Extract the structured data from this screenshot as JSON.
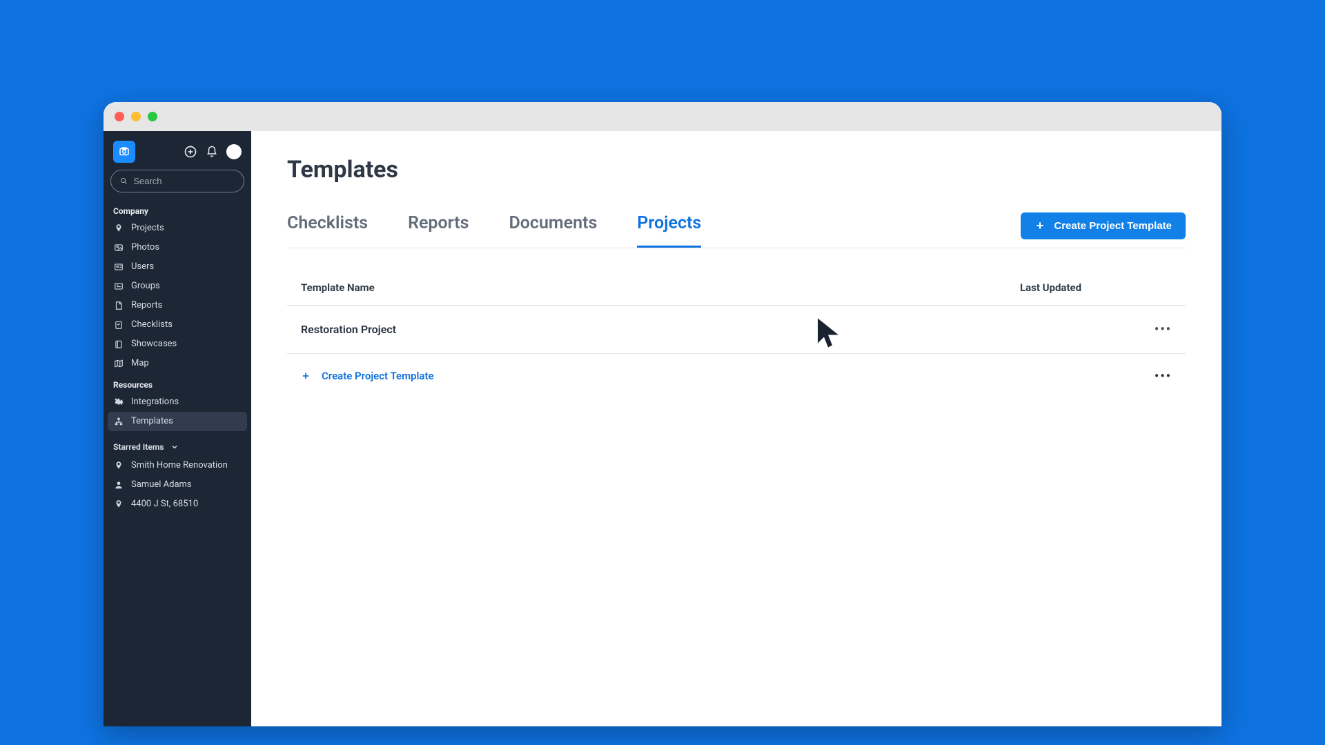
{
  "sidebar": {
    "search_placeholder": "Search",
    "sections": {
      "company": {
        "label": "Company",
        "items": [
          {
            "label": "Projects",
            "icon": "pin"
          },
          {
            "label": "Photos",
            "icon": "image"
          },
          {
            "label": "Users",
            "icon": "user-card"
          },
          {
            "label": "Groups",
            "icon": "group"
          },
          {
            "label": "Reports",
            "icon": "file"
          },
          {
            "label": "Checklists",
            "icon": "checklist"
          },
          {
            "label": "Showcases",
            "icon": "book"
          },
          {
            "label": "Map",
            "icon": "map"
          }
        ]
      },
      "resources": {
        "label": "Resources",
        "items": [
          {
            "label": "Integrations",
            "icon": "puzzle"
          },
          {
            "label": "Templates",
            "icon": "sitemap",
            "active": true
          }
        ]
      },
      "starred": {
        "label": "Starred Items",
        "items": [
          {
            "label": "Smith Home Renovation",
            "icon": "pin"
          },
          {
            "label": "Samuel Adams",
            "icon": "person"
          },
          {
            "label": "4400 J St, 68510",
            "icon": "pin"
          }
        ]
      }
    }
  },
  "page": {
    "title": "Templates"
  },
  "tabs": [
    {
      "label": "Checklists"
    },
    {
      "label": "Reports"
    },
    {
      "label": "Documents"
    },
    {
      "label": "Projects",
      "active": true
    }
  ],
  "create_button_label": "Create Project Template",
  "table": {
    "columns": {
      "name": "Template Name",
      "updated": "Last Updated"
    },
    "rows": [
      {
        "name": "Restoration Project",
        "updated": ""
      }
    ],
    "add_row_label": "Create Project Template"
  },
  "colors": {
    "accent": "#0e72e0",
    "sidebar_bg": "#1c2634"
  }
}
